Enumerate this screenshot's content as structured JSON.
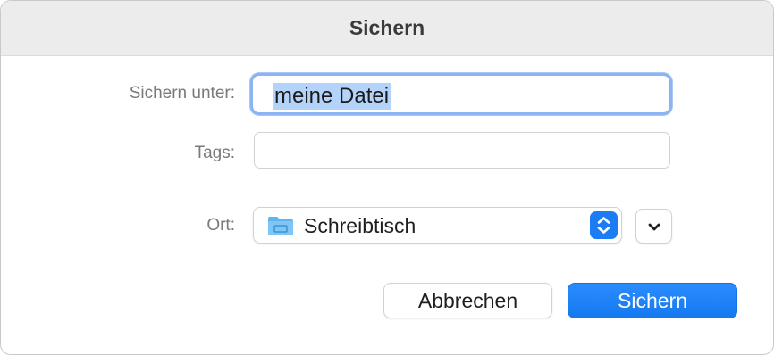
{
  "dialog": {
    "title": "Sichern"
  },
  "form": {
    "save_as_label": "Sichern unter:",
    "save_as_value": "meine Datei",
    "tags_label": "Tags:",
    "tags_value": "",
    "location_label": "Ort:",
    "location_value": "Schreibtisch",
    "location_icon": "folder-icon"
  },
  "buttons": {
    "cancel_label": "Abbrechen",
    "save_label": "Sichern"
  },
  "colors": {
    "accent": "#1c7cf4",
    "selection": "#b4d3fb",
    "focus_ring": "#8db4f2"
  }
}
